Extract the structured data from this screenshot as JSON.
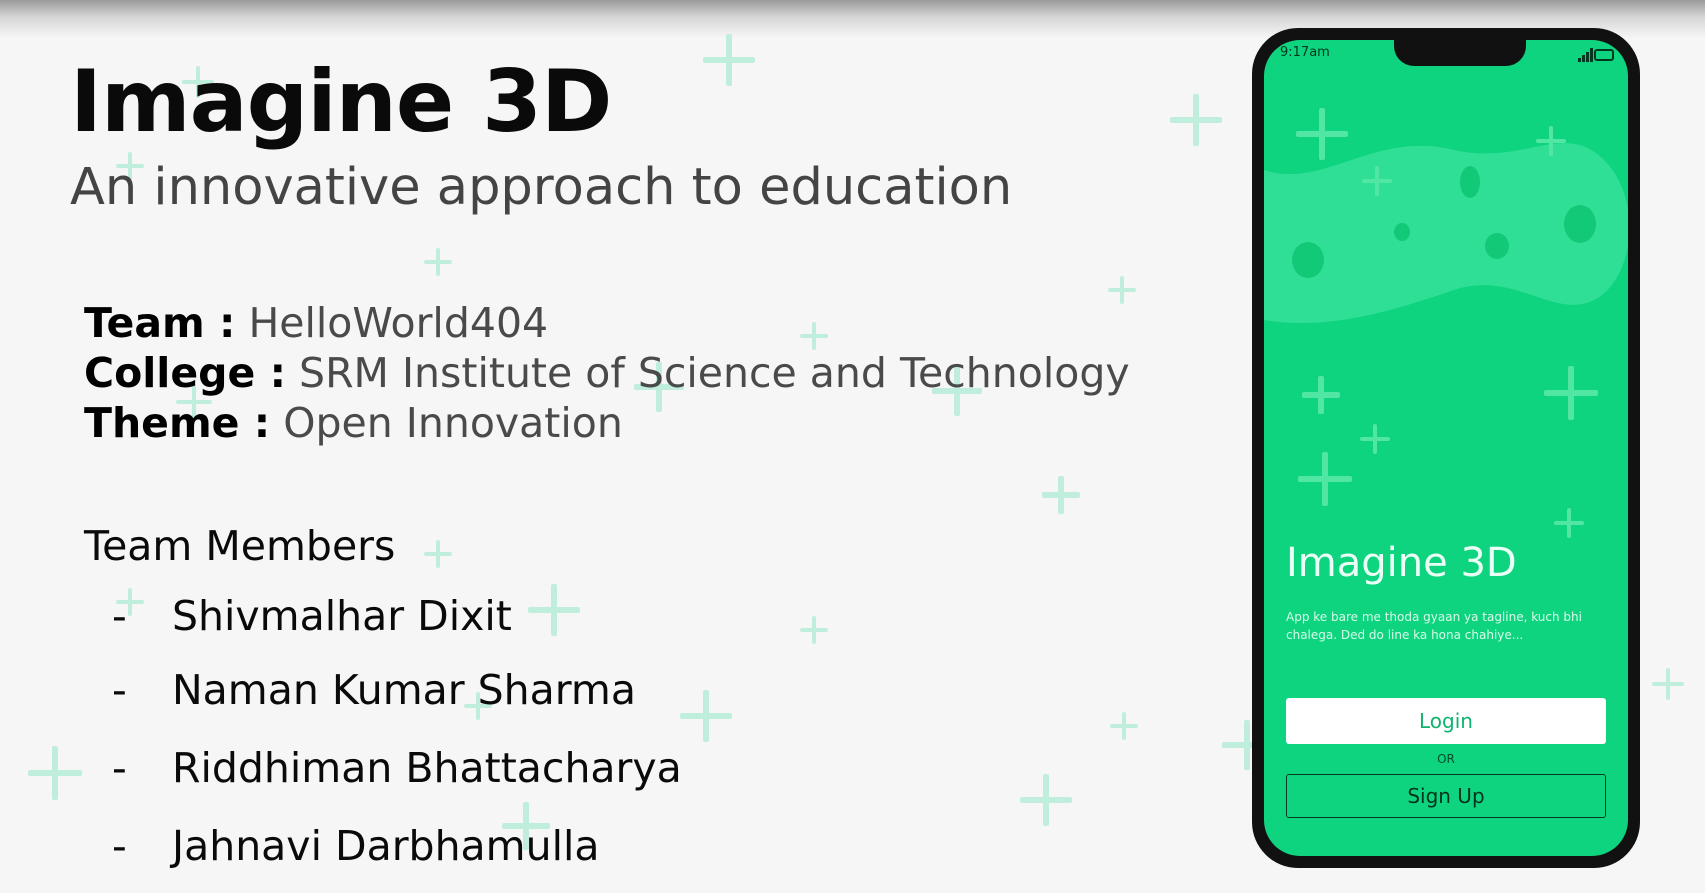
{
  "slide": {
    "title": "Imagine 3D",
    "subtitle": "An innovative approach to education",
    "info": [
      {
        "label": "Team :",
        "value": "HelloWorld404"
      },
      {
        "label": "College :",
        "value": "SRM Institute of Science and Technology"
      },
      {
        "label": "Theme :",
        "value": "Open Innovation"
      }
    ],
    "members_heading": "Team Members",
    "bullet": "-",
    "members": [
      "Shivmalhar Dixit",
      "Naman Kumar Sharma",
      "Riddhiman Bhattacharya",
      "Jahnavi Darbhamulla"
    ],
    "accent_color": "#0fd47f",
    "decoration_color": "#bfeedd"
  },
  "phone": {
    "status_time": "9:17am",
    "status_icons": [
      "signal-icon",
      "battery-icon"
    ],
    "app_title": "Imagine 3D",
    "tagline": "App ke bare me thoda gyaan ya tagline, kuch bhi chalega. Ded do line ka hona chahiye...",
    "login_label": "Login",
    "or_label": "OR",
    "signup_label": "Sign Up"
  }
}
